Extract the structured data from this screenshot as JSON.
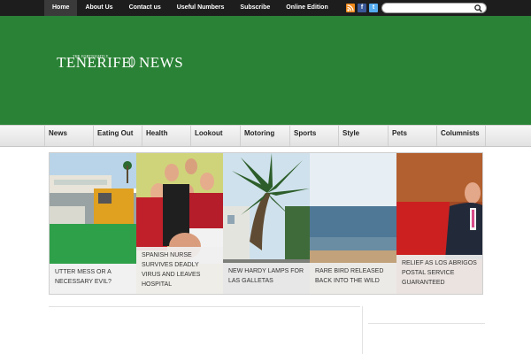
{
  "top_nav": {
    "items": [
      {
        "label": "Home",
        "active": true
      },
      {
        "label": "About Us"
      },
      {
        "label": "Contact us"
      },
      {
        "label": "Useful Numbers"
      },
      {
        "label": "Subscribe"
      },
      {
        "label": "Online Edition"
      }
    ]
  },
  "social": {
    "rss": "RSS",
    "facebook": "f",
    "twitter": "t"
  },
  "search": {
    "value": "",
    "placeholder": ""
  },
  "logo": {
    "tagline": "THE FORTNIGHTLY",
    "name_left": "TENERIFE",
    "name_right": "NEWS"
  },
  "main_nav": {
    "items": [
      "News",
      "Eating Out",
      "Health",
      "Lookout",
      "Motoring",
      "Sports",
      "Style",
      "Pets",
      "Columnists"
    ]
  },
  "slides": [
    {
      "caption": "Utter mess or a necessary evil?"
    },
    {
      "caption": "Spanish nurse survives deadly virus and leaves hospital"
    },
    {
      "caption": "New hardy lamps for Las Galletas"
    },
    {
      "caption": "Rare bird released back into the wild"
    },
    {
      "caption": "Relief as Los Abrigos postal service guaranteed"
    }
  ],
  "colors": {
    "header_green": "#2a8236",
    "topbar": "#1d1d1d"
  }
}
